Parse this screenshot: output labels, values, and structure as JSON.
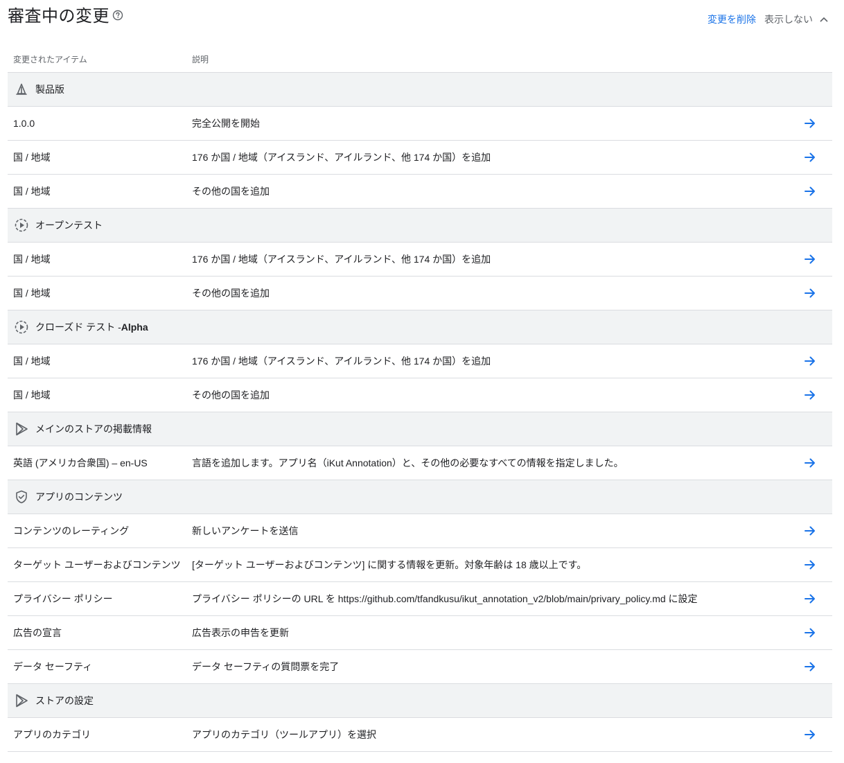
{
  "header": {
    "title": "審査中の変更",
    "discard_label": "変更を削除",
    "hide_label": "表示しない"
  },
  "table": {
    "columns": {
      "item": "変更されたアイテム",
      "description": "説明"
    },
    "sections": [
      {
        "label": "製品版",
        "icon": "production-icon",
        "rows": [
          {
            "item": "1.0.0",
            "description": "完全公開を開始"
          },
          {
            "item": "国 / 地域",
            "description": "176 か国 / 地域（アイスランド、アイルランド、他 174 か国）を追加"
          },
          {
            "item": "国 / 地域",
            "description": "その他の国を追加"
          }
        ]
      },
      {
        "label": "オープンテスト",
        "icon": "testing-icon",
        "rows": [
          {
            "item": "国 / 地域",
            "description": "176 か国 / 地域（アイスランド、アイルランド、他 174 か国）を追加"
          },
          {
            "item": "国 / 地域",
            "description": "その他の国を追加"
          }
        ]
      },
      {
        "label": "クローズド テスト - ",
        "label_bold": "Alpha",
        "icon": "testing-icon",
        "rows": [
          {
            "item": "国 / 地域",
            "description": "176 か国 / 地域（アイスランド、アイルランド、他 174 か国）を追加"
          },
          {
            "item": "国 / 地域",
            "description": "その他の国を追加"
          }
        ]
      },
      {
        "label": "メインのストアの掲載情報",
        "icon": "play-store-icon",
        "rows": [
          {
            "item": "英語 (アメリカ合衆国) – en-US",
            "description": "言語を追加します。アプリ名（iKut Annotation）と、その他の必要なすべての情報を指定しました。"
          }
        ]
      },
      {
        "label": "アプリのコンテンツ",
        "icon": "shield-check-icon",
        "rows": [
          {
            "item": "コンテンツのレーティング",
            "description": "新しいアンケートを送信"
          },
          {
            "item": "ターゲット ユーザーおよびコンテンツ",
            "description": "[ターゲット ユーザーおよびコンテンツ] に関する情報を更新。対象年齢は 18 歳以上です。"
          },
          {
            "item": "プライバシー ポリシー",
            "description": "プライバシー ポリシーの URL を https://github.com/tfandkusu/ikut_annotation_v2/blob/main/privary_policy.md に設定"
          },
          {
            "item": "広告の宣言",
            "description": "広告表示の申告を更新"
          },
          {
            "item": "データ セーフティ",
            "description": "データ セーフティの質問票を完了"
          }
        ]
      },
      {
        "label": "ストアの設定",
        "icon": "play-store-icon",
        "rows": [
          {
            "item": "アプリのカテゴリ",
            "description": "アプリのカテゴリ（ツールアプリ）を選択"
          }
        ]
      }
    ]
  },
  "colors": {
    "accent": "#1a73e8",
    "section_bg": "#f1f3f4",
    "divider": "#dadce0",
    "muted_text": "#5f6368"
  }
}
